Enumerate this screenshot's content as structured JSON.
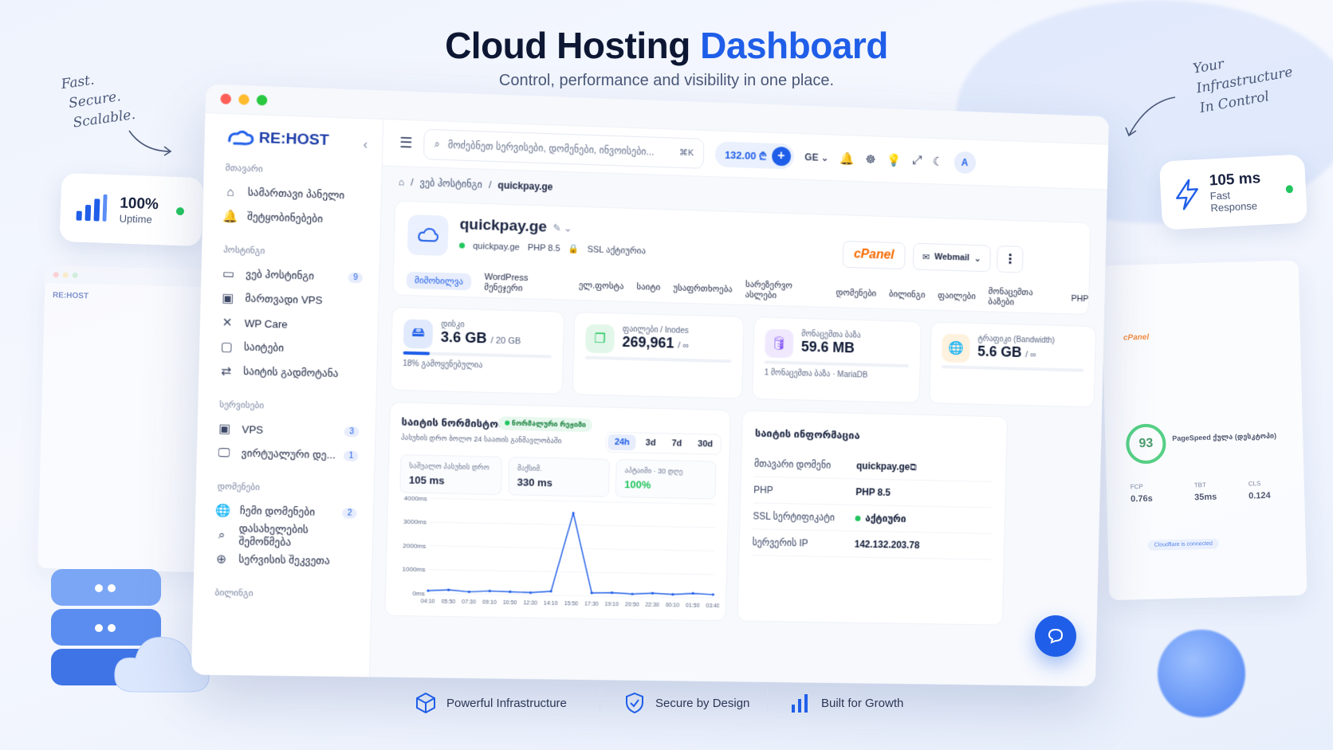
{
  "hero": {
    "title_main": "Cloud Hosting",
    "title_accent": "Dashboard",
    "subtitle": "Control, performance and visibility in one place."
  },
  "notes": {
    "left_1": "Fast.",
    "left_2": "Secure.",
    "left_3": "Scalable.",
    "right_1": "Your",
    "right_2": "Infrastructure",
    "right_3": "In Control"
  },
  "stats": {
    "uptime_value": "100%",
    "uptime_label": "Uptime",
    "response_value": "105 ms",
    "response_label": "Fast Response"
  },
  "brand": {
    "logo": "RE:HOST",
    "accent": "#1f5ee8"
  },
  "sidebar": {
    "sections": [
      {
        "title": "მთავარი",
        "items": [
          {
            "label": "სამართავი პანელი",
            "icon": "home-icon"
          },
          {
            "label": "შეტყობინებები",
            "icon": "bell-icon"
          }
        ]
      },
      {
        "title": "ჰოსტინგი",
        "items": [
          {
            "label": "ვებ ჰოსტინგი",
            "icon": "server-icon",
            "badge": "9"
          },
          {
            "label": "მართვადი VPS",
            "icon": "chip-icon"
          },
          {
            "label": "WP Care",
            "icon": "wrench-icon"
          },
          {
            "label": "საიტები",
            "icon": "folder-icon"
          },
          {
            "label": "საიტის გადმოტანა",
            "icon": "transfer-icon"
          }
        ]
      },
      {
        "title": "სერვისები",
        "items": [
          {
            "label": "VPS",
            "icon": "chip-icon",
            "badge": "3"
          },
          {
            "label": "ვირტუალური დე...",
            "icon": "monitor-icon",
            "badge": "1"
          }
        ]
      },
      {
        "title": "დომენები",
        "items": [
          {
            "label": "ჩემი დომენები",
            "icon": "globe-icon",
            "badge": "2"
          },
          {
            "label": "დასახელების შემოწმება",
            "icon": "search-icon"
          },
          {
            "label": "სერვისის შეკვეთა",
            "icon": "plus-icon"
          }
        ]
      }
    ],
    "last_section": "ბილინგი"
  },
  "topbar": {
    "search_placeholder": "მოძებნეთ სერვისები, დომენები, ინვოისები...",
    "shortcut": "⌘K",
    "balance": "132.00 ₾",
    "lang": "GE",
    "avatar": "A"
  },
  "breadcrumb": {
    "parent": "ვებ ჰოსტინგი",
    "current": "quickpay.ge"
  },
  "site": {
    "domain": "quickpay.ge",
    "subdomain": "quickpay.ge",
    "php": "PHP 8.5",
    "ssl": "SSL აქტიურია",
    "cpanel": "cPanel",
    "webmail": "Webmail",
    "tabs": [
      "მიმოხილვა",
      "WordPress მენეჯერი",
      "ელ.ფოსტა",
      "საიტი",
      "უსაფრთხოება",
      "სარეზერვო ასლები",
      "დომენები",
      "ბილინგი",
      "ფაილები",
      "მონაცემთა ბაზები",
      "PHP"
    ]
  },
  "metrics": [
    {
      "label": "დისკი",
      "value": "3.6 GB",
      "unit": "/ 20 GB",
      "sub": "18% გამოყენებულია",
      "pct": 18,
      "icon": "disk-icon",
      "color": "#1f5ee8"
    },
    {
      "label": "ფაილები / Inodes",
      "value": "269,961",
      "unit": "/ ∞",
      "sub": "",
      "pct": 0,
      "icon": "files-icon",
      "color": "#22c55e"
    },
    {
      "label": "მონაცემთა ბაზა",
      "value": "59.6 MB",
      "unit": "",
      "sub": "1 მონაცემთა ბაზა · MariaDB",
      "pct": 0,
      "icon": "database-icon",
      "color": "#8b5cf6"
    },
    {
      "label": "ტრაფიკი (Bandwidth)",
      "value": "5.6 GB",
      "unit": "/ ∞",
      "sub": "",
      "pct": 0,
      "icon": "globe-icon",
      "color": "#f59e0b"
    }
  ],
  "status": {
    "title": "საიტის ნორმისტობა",
    "badge": "ნორმალური რეჟიმი",
    "desc": "პასუხის დრო ბოლო 24 საათის განმავლობაში",
    "ranges": [
      "24h",
      "3d",
      "7d",
      "30d"
    ],
    "cards": [
      {
        "label": "საშუალო პასუხის დრო",
        "value": "105 ms"
      },
      {
        "label": "მაქსიმ.",
        "value": "330 ms"
      },
      {
        "label": "აპტაიმი · 30 დღე",
        "value": "100%"
      }
    ]
  },
  "chart_data": {
    "type": "line",
    "x": [
      "04:10",
      "05:50",
      "07:30",
      "09:10",
      "10:50",
      "12:30",
      "14:10",
      "15:50",
      "17:30",
      "19:10",
      "20:50",
      "22:30",
      "00:10",
      "01:50",
      "03:40"
    ],
    "y_ticks": [
      "4000ms",
      "3000ms",
      "2000ms",
      "1000ms",
      "0ms"
    ],
    "ylim": [
      0,
      4000
    ],
    "series": [
      {
        "values": [
          110,
          160,
          90,
          140,
          120,
          100,
          170,
          3500,
          130,
          150,
          110,
          160,
          120,
          180,
          140
        ]
      }
    ]
  },
  "info": {
    "title": "საიტის ინფორმაცია",
    "rows": [
      {
        "k": "მთავარი დომენი",
        "v": "quickpay.ge"
      },
      {
        "k": "PHP",
        "v": "PHP 8.5"
      },
      {
        "k": "SSL სერტიფიკატი",
        "v": "აქტიური"
      },
      {
        "k": "სერვერის IP",
        "v": "142.132.203.78"
      }
    ]
  },
  "pagespeed": {
    "score": "93",
    "label": "PageSpeed ქულა (დესკტოპი)",
    "fcp_l": "FCP",
    "fcp": "0.76s",
    "tbt_l": "TBT",
    "tbt": "35ms",
    "cls_l": "CLS",
    "cls": "0.124",
    "cloudflare": "Cloudflare is connected"
  },
  "features": [
    "Powerful Infrastructure",
    "Secure by Design",
    "Built for Growth"
  ]
}
